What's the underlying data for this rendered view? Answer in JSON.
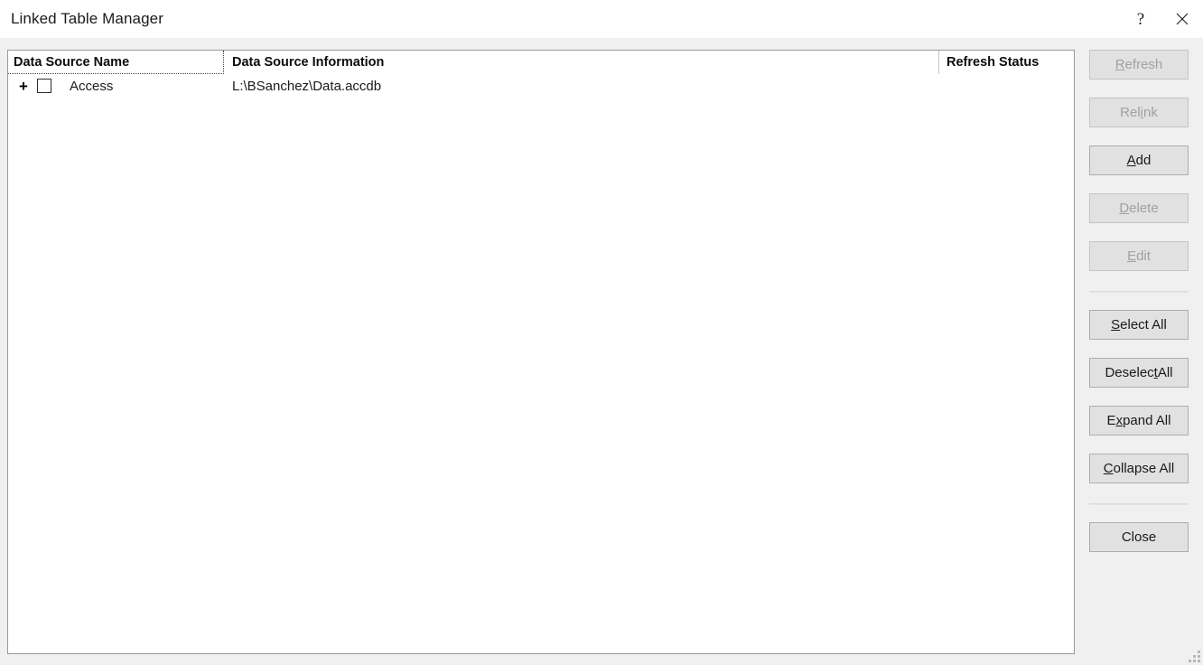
{
  "window": {
    "title": "Linked Table Manager",
    "help_button_glyph": "?",
    "close_button_label": "Close window"
  },
  "grid": {
    "columns": [
      {
        "key": "name",
        "label": "Data Source Name"
      },
      {
        "key": "info",
        "label": "Data Source Information"
      },
      {
        "key": "status",
        "label": "Refresh Status"
      }
    ],
    "rows": [
      {
        "expander": "+",
        "expanded": false,
        "checked": false,
        "name": "Access",
        "info": "L:\\BSanchez\\Data.accdb",
        "status": ""
      }
    ]
  },
  "buttons": {
    "refresh": {
      "label": "Refresh",
      "accel": "R",
      "enabled": false
    },
    "relink": {
      "label": "Relink",
      "accel": "i",
      "enabled": false
    },
    "add": {
      "label": "Add",
      "accel": "A",
      "enabled": true
    },
    "delete": {
      "label": "Delete",
      "accel": "D",
      "enabled": false
    },
    "edit": {
      "label": "Edit",
      "accel": "E",
      "enabled": false
    },
    "select_all": {
      "label": "Select All",
      "accel": "S",
      "enabled": true
    },
    "deselect_all": {
      "label": "Deselect All",
      "accel": "t",
      "enabled": true
    },
    "expand_all": {
      "label": "Expand All",
      "accel": "x",
      "enabled": true
    },
    "collapse_all": {
      "label": "Collapse All",
      "accel": "C",
      "enabled": true
    },
    "close": {
      "label": "Close",
      "accel": "",
      "enabled": true
    }
  },
  "colors": {
    "window_background": "#f0f0f0",
    "panel_background": "#ffffff",
    "panel_border": "#9a9a9a",
    "button_face": "#e1e1e1",
    "button_border": "#adadad",
    "disabled_text": "#a0a0a0",
    "text": "#1a1a1a"
  }
}
